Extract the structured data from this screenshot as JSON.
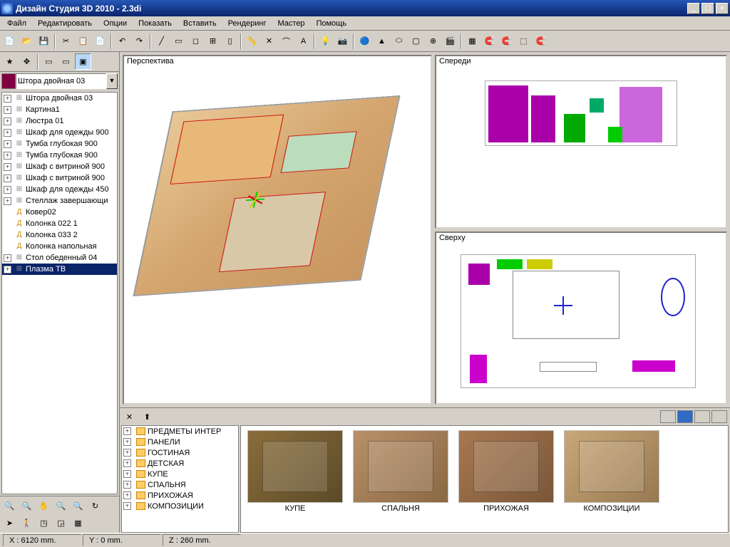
{
  "window": {
    "title": "Дизайн Студия 3D 2010 - 2.3di"
  },
  "menu": [
    "Файл",
    "Редактировать",
    "Опции",
    "Показать",
    "Вставить",
    "Рендеринг",
    "Мастер",
    "Помощь"
  ],
  "object_combo": "Штора двойная 03",
  "scene_tree": [
    {
      "exp": "+",
      "ico": "group",
      "label": "Штора двойная 03"
    },
    {
      "exp": "+",
      "ico": "group",
      "label": "Картина1"
    },
    {
      "exp": "+",
      "ico": "group",
      "label": "Люстра 01"
    },
    {
      "exp": "+",
      "ico": "group",
      "label": "Шкаф для одежды 900"
    },
    {
      "exp": "+",
      "ico": "group",
      "label": "Тумба глубокая 900"
    },
    {
      "exp": "+",
      "ico": "group",
      "label": "Тумба глубокая 900"
    },
    {
      "exp": "+",
      "ico": "group",
      "label": "Шкаф с витриной 900"
    },
    {
      "exp": "+",
      "ico": "group",
      "label": "Шкаф с витриной 900"
    },
    {
      "exp": "+",
      "ico": "group",
      "label": "Шкаф для одежды 450"
    },
    {
      "exp": "+",
      "ico": "group",
      "label": "Стеллаж завершающи"
    },
    {
      "exp": "",
      "ico": "obj",
      "label": "Ковер02"
    },
    {
      "exp": "",
      "ico": "obj",
      "label": "Колонка 022 1"
    },
    {
      "exp": "",
      "ico": "obj",
      "label": "Колонка 033 2"
    },
    {
      "exp": "",
      "ico": "obj",
      "label": "Колонка напольная"
    },
    {
      "exp": "+",
      "ico": "group",
      "label": "Стол обеденный 04"
    },
    {
      "exp": "+",
      "ico": "group",
      "label": "Плазма ТВ",
      "selected": true
    }
  ],
  "viewports": {
    "perspective": "Перспектива",
    "front": "Спереди",
    "top": "Сверху"
  },
  "categories": [
    "ПРЕДМЕТЫ ИНТЕР",
    "ПАНЕЛИ",
    "ГОСТИНАЯ",
    "ДЕТСКАЯ",
    "КУПЕ",
    "СПАЛЬНЯ",
    "ПРИХОЖАЯ",
    "КОМПОЗИЦИИ"
  ],
  "thumbnails": [
    {
      "label": "КУПЕ"
    },
    {
      "label": "СПАЛЬНЯ"
    },
    {
      "label": "ПРИХОЖАЯ"
    },
    {
      "label": "КОМПОЗИЦИИ"
    }
  ],
  "status": {
    "x": "X : 6120 mm.",
    "y": "Y : 0 mm.",
    "z": "Z : 260 mm."
  }
}
